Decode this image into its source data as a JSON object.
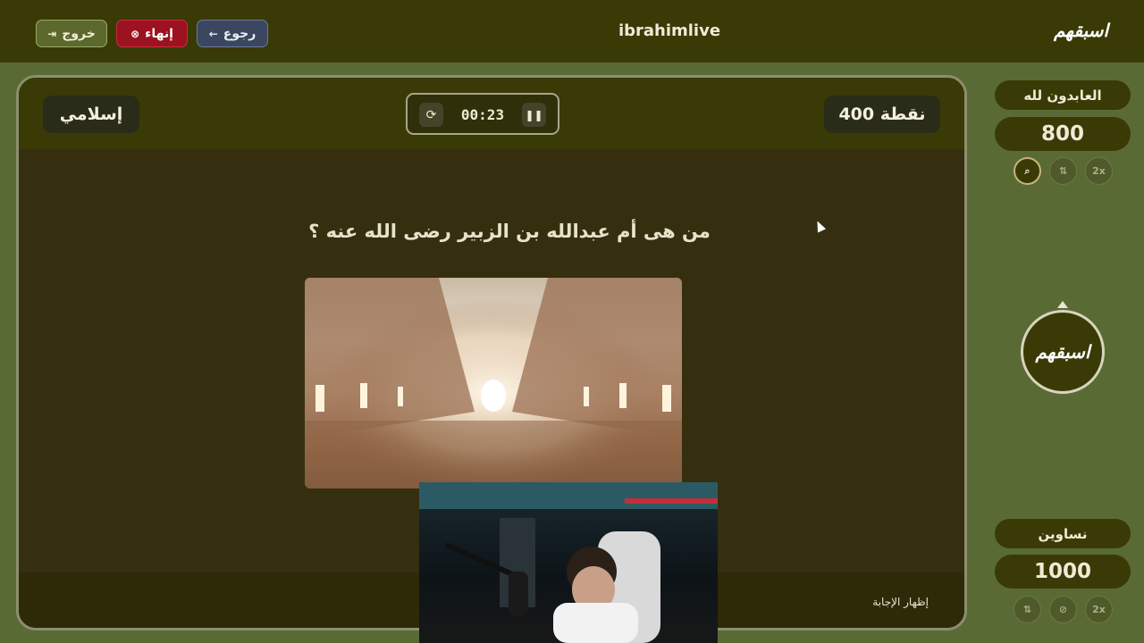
{
  "topbar": {
    "exit_label": "خروج",
    "end_label": "إنهاء",
    "back_label": "رجوع",
    "title": "ibrahimlive",
    "logo": "اسبقهم"
  },
  "card": {
    "category": "إسلامي",
    "points": "400 نقطة",
    "timer": "00:23",
    "question": "من هى أم عبدالله بن الزبير رضى الله عنه ؟",
    "show_answer": "إظهار الإجابة"
  },
  "teams": [
    {
      "name": "العابدون لله",
      "score": "800",
      "aids": [
        "search",
        "swap",
        "2x"
      ]
    },
    {
      "name": "نساوين",
      "score": "1000",
      "aids": [
        "swap",
        "block",
        "2x"
      ]
    }
  ],
  "turn": {
    "label": "اسبقهم"
  },
  "colors": {
    "topbar": "#3a3a06",
    "background": "#5a6a35",
    "card": "#352f10",
    "end_button": "#9c1220",
    "back_button": "#3b4760"
  }
}
